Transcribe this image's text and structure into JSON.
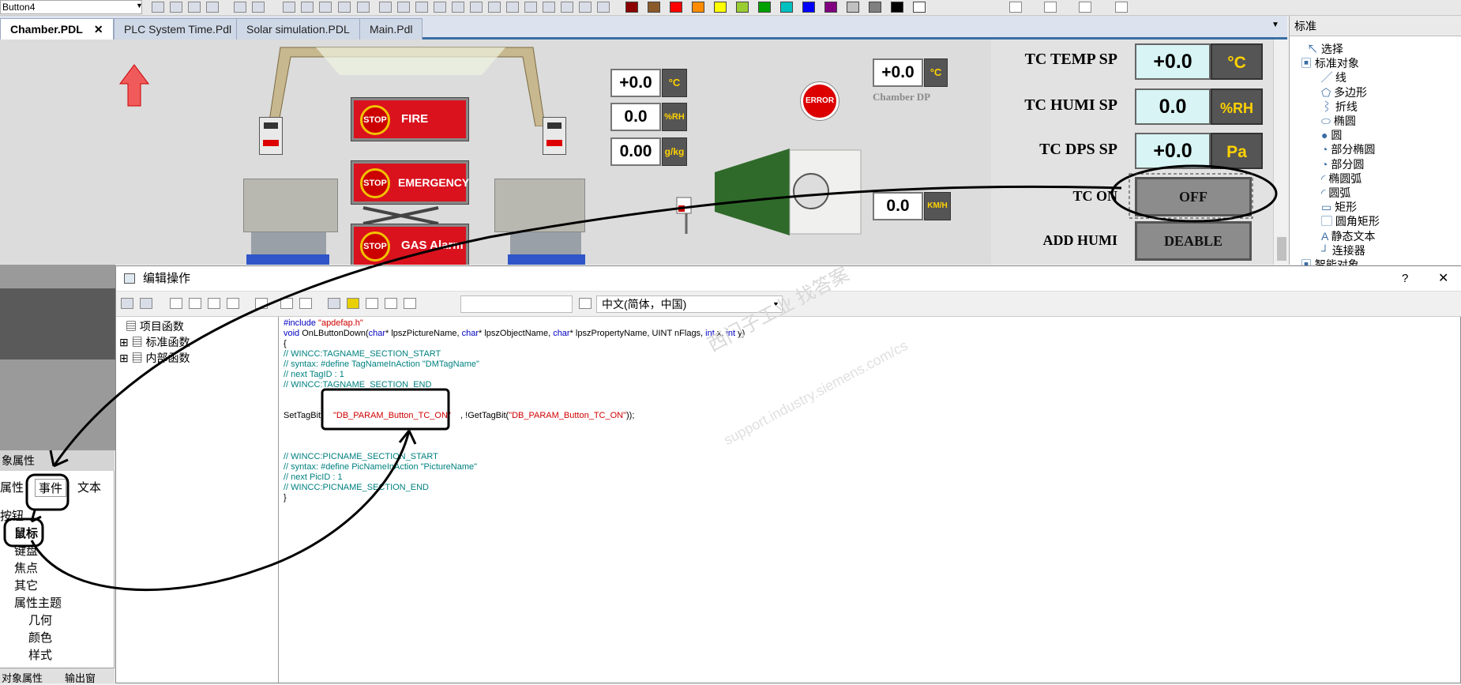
{
  "toolbar": {
    "object_name": "Button4",
    "swatches": [
      "#8b0000",
      "#8b5a2b",
      "#ff0000",
      "#ff8c00",
      "#ffff00",
      "#9acd32",
      "#00a000",
      "#00c0c0",
      "#0000ff",
      "#800080",
      "#c0c0c0",
      "#808080",
      "#000000",
      "#ffffff"
    ]
  },
  "tabs": [
    {
      "label": "Chamber.PDL",
      "active": true,
      "close": "✕"
    },
    {
      "label": "PLC System Time.Pdl",
      "active": false
    },
    {
      "label": "Solar simulation.PDL",
      "active": false
    },
    {
      "label": "Main.Pdl",
      "active": false
    }
  ],
  "canvas": {
    "stop_buttons": [
      {
        "badge": "STOP",
        "label": "FIRE"
      },
      {
        "badge": "STOP",
        "label": "EMERGENCY"
      },
      {
        "badge": "STOP",
        "label": "GAS Alarm"
      }
    ],
    "readouts": [
      {
        "value": "+0.0",
        "unit": "°C"
      },
      {
        "value": "0.0",
        "unit": "%RH"
      },
      {
        "value": "0.00",
        "unit": "g/kg"
      }
    ],
    "chamber_dp": {
      "value": "+0.0",
      "unit": "°C",
      "label": "Chamber DP"
    },
    "speed": {
      "value": "0.0",
      "unit": "KM/H"
    },
    "error_badge": "ERROR"
  },
  "tc_panel": {
    "rows": [
      {
        "label": "TC TEMP SP",
        "value": "+0.0",
        "unit": "°C"
      },
      {
        "label": "TC HUMI SP",
        "value": "0.0",
        "unit": "%RH"
      },
      {
        "label": "TC DPS SP",
        "value": "+0.0",
        "unit": "Pa"
      }
    ],
    "tc_on": {
      "label": "TC ON",
      "button": "OFF"
    },
    "add_humi": {
      "label": "ADD HUMI",
      "button": "DEABLE"
    }
  },
  "palette": {
    "header": "标准",
    "items": [
      "选择",
      "标准对象",
      "线",
      "多边形",
      "折线",
      "椭圆",
      "圆",
      "部分椭圆",
      "部分圆",
      "椭圆弧",
      "圆弧",
      "矩形",
      "圆角矩形",
      "静态文本",
      "连接器",
      "智能对象"
    ]
  },
  "props": {
    "header": "象属性",
    "tabs": [
      "属性",
      "事件",
      "文本"
    ],
    "tree": [
      "按钮",
      "鼠标",
      "键盘",
      "焦点",
      "其它",
      "属性主题",
      "几何",
      "颜色",
      "样式"
    ],
    "bottom_tabs": [
      "对象属性",
      "输出窗"
    ]
  },
  "dialog": {
    "title": "编辑操作",
    "help": "?",
    "close": "✕",
    "language": "中文(简体，中国)",
    "tree": [
      "项目函数",
      "标准函数",
      "内部函数"
    ],
    "code": {
      "include_kw": "#include",
      "include_file": "\"apdefap.h\"",
      "sig_void": "void",
      "sig_name": " OnLButtonDown(",
      "sig_char": "char",
      "sig_p1": "* lpszPictureName, ",
      "sig_p2": "* lpszObjectName, ",
      "sig_p3": "* lpszPropertyName, UINT nFlags, ",
      "sig_int": "int",
      "sig_x": " x, ",
      "sig_y": " y)",
      "brace_open": "{",
      "tag_start": "// WINCC:TAGNAME_SECTION_START",
      "tag_syntax": "// syntax: #define TagNameInAction \"DMTagName\"",
      "tag_next": "// next TagID : 1",
      "tag_end": "// WINCC:TAGNAME_SECTION_END",
      "settag_a": "SetTagBit(",
      "settag_s1": "\"DB_PARAM_Button_TC_ON\"",
      "settag_b": ", !GetTagBit(",
      "settag_s2": "\"DB_PARAM_Button_TC_ON\"",
      "settag_c": "));",
      "pic_start": "// WINCC:PICNAME_SECTION_START",
      "pic_syntax": "// syntax: #define PicNameInAction \"PictureName\"",
      "pic_next": "// next PicID : 1",
      "pic_end": "// WINCC:PICNAME_SECTION_END",
      "brace_close": "}"
    },
    "watermark_cn": "西门子工业 找答案",
    "watermark_url": "support.industry.siemens.com/cs"
  }
}
